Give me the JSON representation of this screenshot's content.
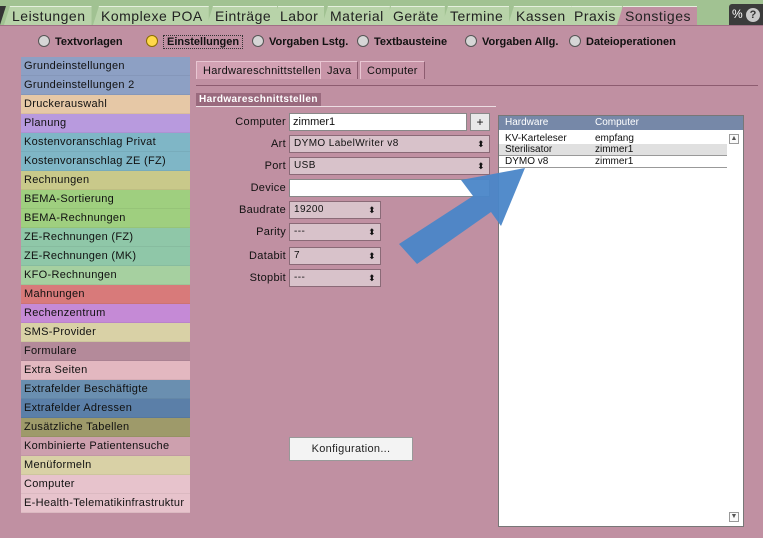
{
  "top_tabs": [
    {
      "label": "Leistungen",
      "active": false
    },
    {
      "label": "Komplexe POA",
      "active": false
    },
    {
      "label": "Einträge",
      "active": false
    },
    {
      "label": "Labor",
      "active": false
    },
    {
      "label": "Material",
      "active": false
    },
    {
      "label": "Geräte",
      "active": false
    },
    {
      "label": "Termine",
      "active": false
    },
    {
      "label": "Kassen",
      "active": false
    },
    {
      "label": "Praxis",
      "active": false
    },
    {
      "label": "Sonstiges",
      "active": true
    }
  ],
  "help_icons": {
    "label": "%",
    "help": "?"
  },
  "sub_tabs_radio": [
    {
      "label": "Textvorlagen",
      "active": false
    },
    {
      "label": "Einstellungen",
      "active": true
    },
    {
      "label": "Vorgaben Lstg.",
      "active": false
    },
    {
      "label": "Textbausteine",
      "active": false
    },
    {
      "label": "Vorgaben Allg.",
      "active": false
    },
    {
      "label": "Dateioperationen",
      "active": false
    }
  ],
  "sidebar_items": [
    {
      "label": "Grundeinstellungen",
      "color": "#8da0c4"
    },
    {
      "label": "Grundeinstellungen 2",
      "color": "#8da0c4"
    },
    {
      "label": "Druckerauswahl",
      "color": "#e6c8a6"
    },
    {
      "label": "Planung",
      "color": "#b89ade"
    },
    {
      "label": "Kostenvoranschlag Privat",
      "color": "#7fb6c6"
    },
    {
      "label": "Kostenvoranschlag ZE (FZ)",
      "color": "#7fb6c6"
    },
    {
      "label": "Rechnungen",
      "color": "#c9c98a"
    },
    {
      "label": "BEMA-Sortierung",
      "color": "#9fcf7f"
    },
    {
      "label": "BEMA-Rechnungen",
      "color": "#9fcf7f"
    },
    {
      "label": "ZE-Rechnungen (FZ)",
      "color": "#8fc7a8"
    },
    {
      "label": "ZE-Rechnungen (MK)",
      "color": "#8fc7a8"
    },
    {
      "label": "KFO-Rechnungen",
      "color": "#a6d0a0"
    },
    {
      "label": "Mahnungen",
      "color": "#d87a7a"
    },
    {
      "label": "Rechenzentrum",
      "color": "#c58ad6"
    },
    {
      "label": "SMS-Provider",
      "color": "#d9d1a6"
    },
    {
      "label": "Formulare",
      "color": "#b48a9a"
    },
    {
      "label": "Extra Seiten",
      "color": "#e3b8c0"
    },
    {
      "label": "Extrafelder Beschäftigte",
      "color": "#6a8fb0"
    },
    {
      "label": "Extrafelder Adressen",
      "color": "#5b7fa8"
    },
    {
      "label": "Zusätzliche Tabellen",
      "color": "#9e9a6a"
    },
    {
      "label": "Kombinierte Patientensuche",
      "color": "#cda0ae"
    },
    {
      "label": "Menüformeln",
      "color": "#d9d1a6"
    },
    {
      "label": "Computer",
      "color": "#e7c3cc"
    },
    {
      "label": "E-Health-Telematikinfrastruktur",
      "color": "#e7c3cc"
    }
  ],
  "main_tabs": [
    {
      "label": "Hardwareschnittstellen",
      "active": true
    },
    {
      "label": "Java",
      "active": false
    },
    {
      "label": "Computer",
      "active": false
    }
  ],
  "section_title": "Hardwareschnittstellen",
  "form": {
    "computer_label": "Computer",
    "computer_value": "zimmer1",
    "plus_label": "+",
    "art_label": "Art",
    "art_value": "DYMO LabelWriter v8",
    "port_label": "Port",
    "port_value": "USB",
    "device_label": "Device",
    "device_value": "",
    "baudrate_label": "Baudrate",
    "baudrate_value": "19200",
    "parity_label": "Parity",
    "parity_value": "---",
    "databit_label": "Databit",
    "databit_value": "7",
    "stopbit_label": "Stopbit",
    "stopbit_value": "---",
    "select_arrows": "⬍"
  },
  "konfiguration_button": "Konfiguration...",
  "hardware_table": {
    "headers": [
      "Hardware",
      "Computer"
    ],
    "rows": [
      {
        "hardware": "KV-Karteleser",
        "computer": "empfang"
      },
      {
        "hardware": "Sterilisator",
        "computer": "zimmer1"
      },
      {
        "hardware": "DYMO v8",
        "computer": "zimmer1"
      }
    ]
  },
  "colors": {
    "accent_pink": "#c090a2",
    "table_header": "#7688a8",
    "arrow_blue": "#4a86c8"
  }
}
